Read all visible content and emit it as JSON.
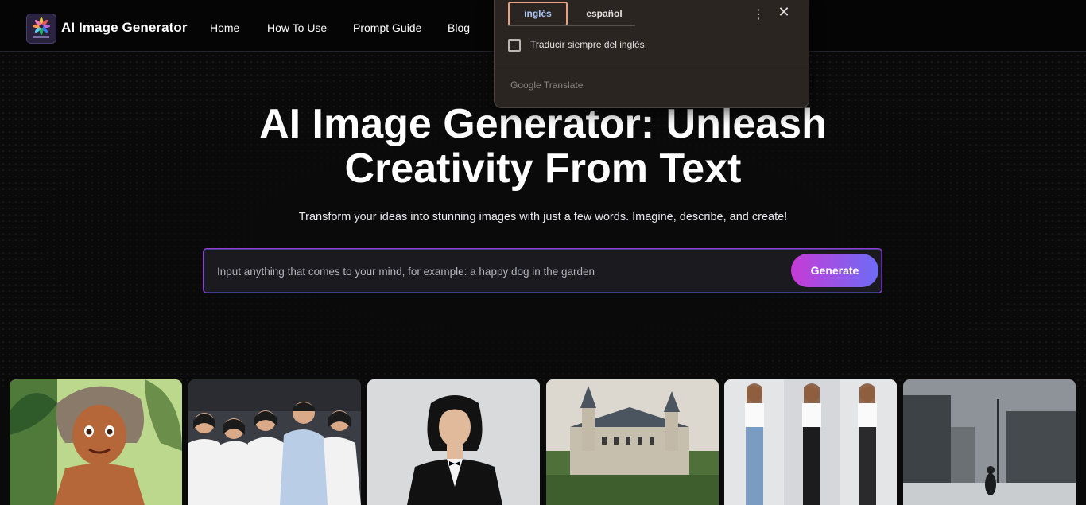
{
  "header": {
    "brand": "AI Image Generator",
    "logo_icon": "colorful-flower-logo-icon",
    "nav": [
      "Home",
      "How To Use",
      "Prompt Guide",
      "Blog"
    ]
  },
  "translate_popup": {
    "source_lang": "inglés",
    "target_lang": "español",
    "always_translate_label": "Traducir siempre del inglés",
    "always_translate_checked": false,
    "footer": "Google Translate",
    "menu_icon": "more-vert-icon",
    "close_icon": "close-icon",
    "active_color": "#a7c4f6",
    "active_border": "#e9a07e"
  },
  "hero": {
    "title_line1": "AI Image Generator: Unleash",
    "title_line2": "Creativity From Text",
    "subtitle": "Transform your ideas into stunning images with just a few words. Imagine, describe, and create!"
  },
  "prompt": {
    "value": "",
    "placeholder": "Input anything that comes to your mind, for example: a happy dog in the garden",
    "button": "Generate"
  },
  "colors": {
    "background": "#0a0a0b",
    "accent_gradient_start": "#c63bd6",
    "accent_gradient_end": "#6d6cf6"
  },
  "gallery": [
    {
      "icon": "jungle-boy-cartoon-image"
    },
    {
      "icon": "group-of-office-workers-image"
    },
    {
      "icon": "woman-in-tuxedo-image"
    },
    {
      "icon": "chateau-castle-image"
    },
    {
      "icon": "three-women-posing-image"
    },
    {
      "icon": "foggy-city-street-image"
    }
  ]
}
